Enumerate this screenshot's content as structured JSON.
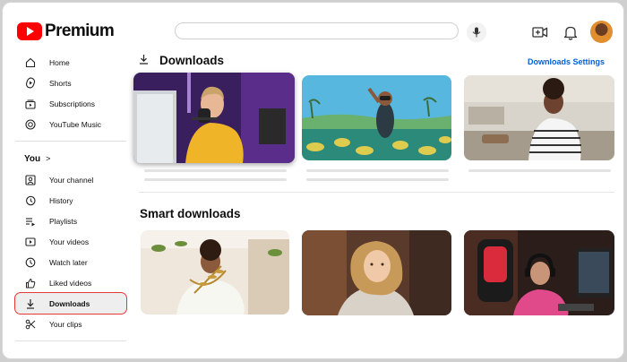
{
  "header": {
    "brand": "Premium"
  },
  "sidebar": {
    "main_items": [
      {
        "label": "Home",
        "icon": "home-icon"
      },
      {
        "label": "Shorts",
        "icon": "shorts-icon"
      },
      {
        "label": "Subscriptions",
        "icon": "subscriptions-icon"
      },
      {
        "label": "YouTube Music",
        "icon": "music-icon"
      }
    ],
    "you_label": "You",
    "you_chevron": ">",
    "you_items": [
      {
        "label": "Your channel",
        "icon": "channel-icon"
      },
      {
        "label": "History",
        "icon": "history-icon"
      },
      {
        "label": "Playlists",
        "icon": "playlists-icon"
      },
      {
        "label": "Your videos",
        "icon": "videos-icon"
      },
      {
        "label": "Watch later",
        "icon": "watch-later-icon"
      },
      {
        "label": "Liked videos",
        "icon": "liked-icon"
      },
      {
        "label": "Downloads",
        "icon": "download-icon",
        "active": true
      },
      {
        "label": "Your clips",
        "icon": "clips-icon"
      }
    ]
  },
  "main": {
    "downloads_title": "Downloads",
    "downloads_settings": "Downloads Settings",
    "smart_title": "Smart downloads"
  },
  "colors": {
    "brand_red": "#ff0000",
    "link_blue": "#065fd4",
    "highlight_outline": "#e53935"
  }
}
